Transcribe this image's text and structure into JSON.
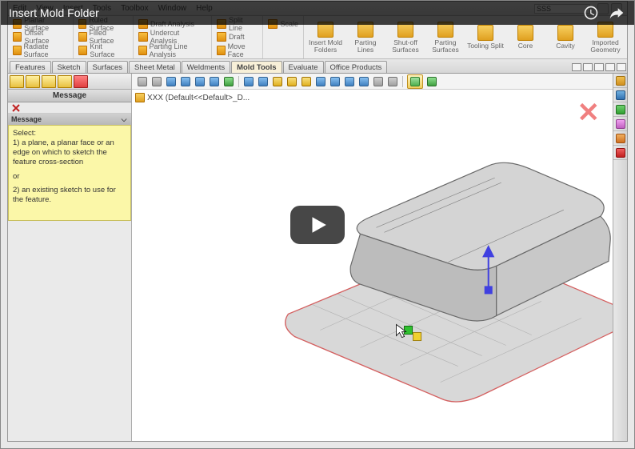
{
  "video": {
    "title": "Insert Mold Folder"
  },
  "menu": {
    "items": [
      "Edit",
      "View",
      "Insert",
      "Tools",
      "Toolbox",
      "Window",
      "Help"
    ],
    "search": "SSS"
  },
  "ribbon": {
    "g1": [
      "Planar Surface",
      "Offset Surface",
      "Radiate Surface"
    ],
    "g2": [
      "Ruled Surface",
      "Filled Surface",
      "Knit Surface"
    ],
    "g3": [
      "Draft Analysis",
      "Undercut Analysis",
      "Parting Line Analysis"
    ],
    "g4": [
      "Split Line",
      "Draft",
      "Move Face"
    ],
    "g4b": [
      "Scale",
      "",
      ""
    ],
    "big": [
      "Insert Mold Folders",
      "Parting Lines",
      "Shut-off Surfaces",
      "Parting Surfaces",
      "Tooling Split",
      "Core",
      "Cavity",
      "Imported Geometry"
    ]
  },
  "tabs": [
    "Features",
    "Sketch",
    "Surfaces",
    "Sheet Metal",
    "Weldments",
    "Mold Tools",
    "Evaluate",
    "Office Products"
  ],
  "activeTab": 5,
  "side": {
    "header": "Message",
    "msgbar": "Message",
    "note_l1": "Select:",
    "note_l2": "1) a plane, a planar face or an edge on which to sketch the feature cross-section",
    "note_or": "or",
    "note_l3": "2) an existing sketch to use for the feature."
  },
  "tree": {
    "root": "XXX  (Default<<Default>_D..."
  }
}
